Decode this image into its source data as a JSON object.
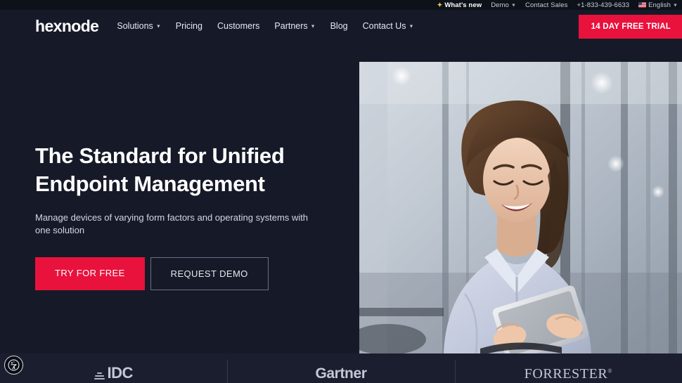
{
  "utility_bar": {
    "items": [
      {
        "label": "What's new",
        "icon": "sparkle-icon",
        "bold": true,
        "chevron": false,
        "flag": false
      },
      {
        "label": "Demo",
        "icon": "",
        "bold": false,
        "chevron": true,
        "flag": false
      },
      {
        "label": "Contact Sales",
        "icon": "",
        "bold": false,
        "chevron": false,
        "flag": false
      },
      {
        "label": "+1-833-439-6633",
        "icon": "",
        "bold": false,
        "chevron": false,
        "flag": false
      },
      {
        "label": "English",
        "icon": "us-flag-icon",
        "bold": false,
        "chevron": true,
        "flag": true
      }
    ]
  },
  "nav": {
    "logo": "hexnode",
    "links": [
      {
        "label": "Solutions",
        "chevron": true
      },
      {
        "label": "Pricing",
        "chevron": false
      },
      {
        "label": "Customers",
        "chevron": false
      },
      {
        "label": "Partners",
        "chevron": true
      },
      {
        "label": "Blog",
        "chevron": false
      },
      {
        "label": "Contact Us",
        "chevron": true
      }
    ],
    "cta_label": "14 DAY FREE TRIAL"
  },
  "hero": {
    "title_line1": "The Standard for Unified",
    "title_line2": "Endpoint Management",
    "subtitle": "Manage devices of varying form factors and operating systems with one solution",
    "primary_button": "TRY FOR FREE",
    "secondary_button": "REQUEST DEMO",
    "image_alt": "Smiling businesswoman in a light blue shirt holding a tablet in a modern glass office"
  },
  "analyst_bar": {
    "logos": [
      {
        "name": "IDC",
        "text": "IDC"
      },
      {
        "name": "Gartner",
        "text": "Gartner"
      },
      {
        "name": "Forrester",
        "text": "FORRESTER"
      }
    ]
  },
  "accessibility_widget": {
    "name": "accessibility-widget",
    "label": "Accessibility"
  },
  "colors": {
    "background": "#161A28",
    "utility_bar_background": "#0D1119",
    "analyst_bar_background": "#1B1E2E",
    "accent_red": "#E8123C",
    "text_primary": "#FFFFFF",
    "text_secondary": "#D4D7E0",
    "sparkle_gold": "#F2C94C"
  }
}
